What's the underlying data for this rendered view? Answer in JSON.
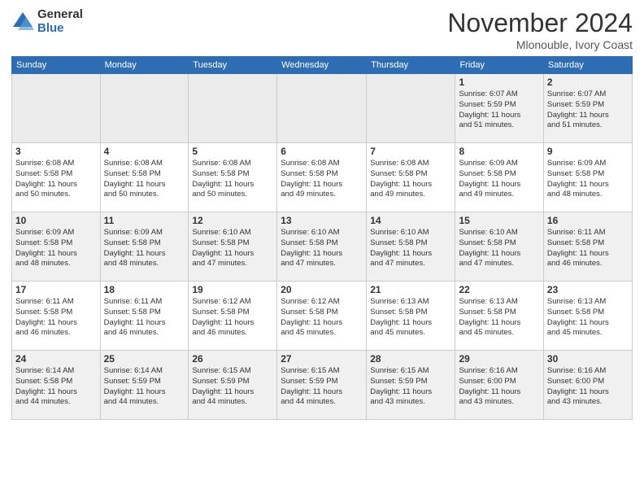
{
  "header": {
    "logo_general": "General",
    "logo_blue": "Blue",
    "month": "November 2024",
    "location": "Mlonouble, Ivory Coast"
  },
  "weekdays": [
    "Sunday",
    "Monday",
    "Tuesday",
    "Wednesday",
    "Thursday",
    "Friday",
    "Saturday"
  ],
  "weeks": [
    [
      {
        "day": "",
        "info": ""
      },
      {
        "day": "",
        "info": ""
      },
      {
        "day": "",
        "info": ""
      },
      {
        "day": "",
        "info": ""
      },
      {
        "day": "",
        "info": ""
      },
      {
        "day": "1",
        "info": "Sunrise: 6:07 AM\nSunset: 5:59 PM\nDaylight: 11 hours\nand 51 minutes."
      },
      {
        "day": "2",
        "info": "Sunrise: 6:07 AM\nSunset: 5:59 PM\nDaylight: 11 hours\nand 51 minutes."
      }
    ],
    [
      {
        "day": "3",
        "info": "Sunrise: 6:08 AM\nSunset: 5:58 PM\nDaylight: 11 hours\nand 50 minutes."
      },
      {
        "day": "4",
        "info": "Sunrise: 6:08 AM\nSunset: 5:58 PM\nDaylight: 11 hours\nand 50 minutes."
      },
      {
        "day": "5",
        "info": "Sunrise: 6:08 AM\nSunset: 5:58 PM\nDaylight: 11 hours\nand 50 minutes."
      },
      {
        "day": "6",
        "info": "Sunrise: 6:08 AM\nSunset: 5:58 PM\nDaylight: 11 hours\nand 49 minutes."
      },
      {
        "day": "7",
        "info": "Sunrise: 6:08 AM\nSunset: 5:58 PM\nDaylight: 11 hours\nand 49 minutes."
      },
      {
        "day": "8",
        "info": "Sunrise: 6:09 AM\nSunset: 5:58 PM\nDaylight: 11 hours\nand 49 minutes."
      },
      {
        "day": "9",
        "info": "Sunrise: 6:09 AM\nSunset: 5:58 PM\nDaylight: 11 hours\nand 48 minutes."
      }
    ],
    [
      {
        "day": "10",
        "info": "Sunrise: 6:09 AM\nSunset: 5:58 PM\nDaylight: 11 hours\nand 48 minutes."
      },
      {
        "day": "11",
        "info": "Sunrise: 6:09 AM\nSunset: 5:58 PM\nDaylight: 11 hours\nand 48 minutes."
      },
      {
        "day": "12",
        "info": "Sunrise: 6:10 AM\nSunset: 5:58 PM\nDaylight: 11 hours\nand 47 minutes."
      },
      {
        "day": "13",
        "info": "Sunrise: 6:10 AM\nSunset: 5:58 PM\nDaylight: 11 hours\nand 47 minutes."
      },
      {
        "day": "14",
        "info": "Sunrise: 6:10 AM\nSunset: 5:58 PM\nDaylight: 11 hours\nand 47 minutes."
      },
      {
        "day": "15",
        "info": "Sunrise: 6:10 AM\nSunset: 5:58 PM\nDaylight: 11 hours\nand 47 minutes."
      },
      {
        "day": "16",
        "info": "Sunrise: 6:11 AM\nSunset: 5:58 PM\nDaylight: 11 hours\nand 46 minutes."
      }
    ],
    [
      {
        "day": "17",
        "info": "Sunrise: 6:11 AM\nSunset: 5:58 PM\nDaylight: 11 hours\nand 46 minutes."
      },
      {
        "day": "18",
        "info": "Sunrise: 6:11 AM\nSunset: 5:58 PM\nDaylight: 11 hours\nand 46 minutes."
      },
      {
        "day": "19",
        "info": "Sunrise: 6:12 AM\nSunset: 5:58 PM\nDaylight: 11 hours\nand 46 minutes."
      },
      {
        "day": "20",
        "info": "Sunrise: 6:12 AM\nSunset: 5:58 PM\nDaylight: 11 hours\nand 45 minutes."
      },
      {
        "day": "21",
        "info": "Sunrise: 6:13 AM\nSunset: 5:58 PM\nDaylight: 11 hours\nand 45 minutes."
      },
      {
        "day": "22",
        "info": "Sunrise: 6:13 AM\nSunset: 5:58 PM\nDaylight: 11 hours\nand 45 minutes."
      },
      {
        "day": "23",
        "info": "Sunrise: 6:13 AM\nSunset: 5:58 PM\nDaylight: 11 hours\nand 45 minutes."
      }
    ],
    [
      {
        "day": "24",
        "info": "Sunrise: 6:14 AM\nSunset: 5:58 PM\nDaylight: 11 hours\nand 44 minutes."
      },
      {
        "day": "25",
        "info": "Sunrise: 6:14 AM\nSunset: 5:59 PM\nDaylight: 11 hours\nand 44 minutes."
      },
      {
        "day": "26",
        "info": "Sunrise: 6:15 AM\nSunset: 5:59 PM\nDaylight: 11 hours\nand 44 minutes."
      },
      {
        "day": "27",
        "info": "Sunrise: 6:15 AM\nSunset: 5:59 PM\nDaylight: 11 hours\nand 44 minutes."
      },
      {
        "day": "28",
        "info": "Sunrise: 6:15 AM\nSunset: 5:59 PM\nDaylight: 11 hours\nand 43 minutes."
      },
      {
        "day": "29",
        "info": "Sunrise: 6:16 AM\nSunset: 6:00 PM\nDaylight: 11 hours\nand 43 minutes."
      },
      {
        "day": "30",
        "info": "Sunrise: 6:16 AM\nSunset: 6:00 PM\nDaylight: 11 hours\nand 43 minutes."
      }
    ]
  ]
}
